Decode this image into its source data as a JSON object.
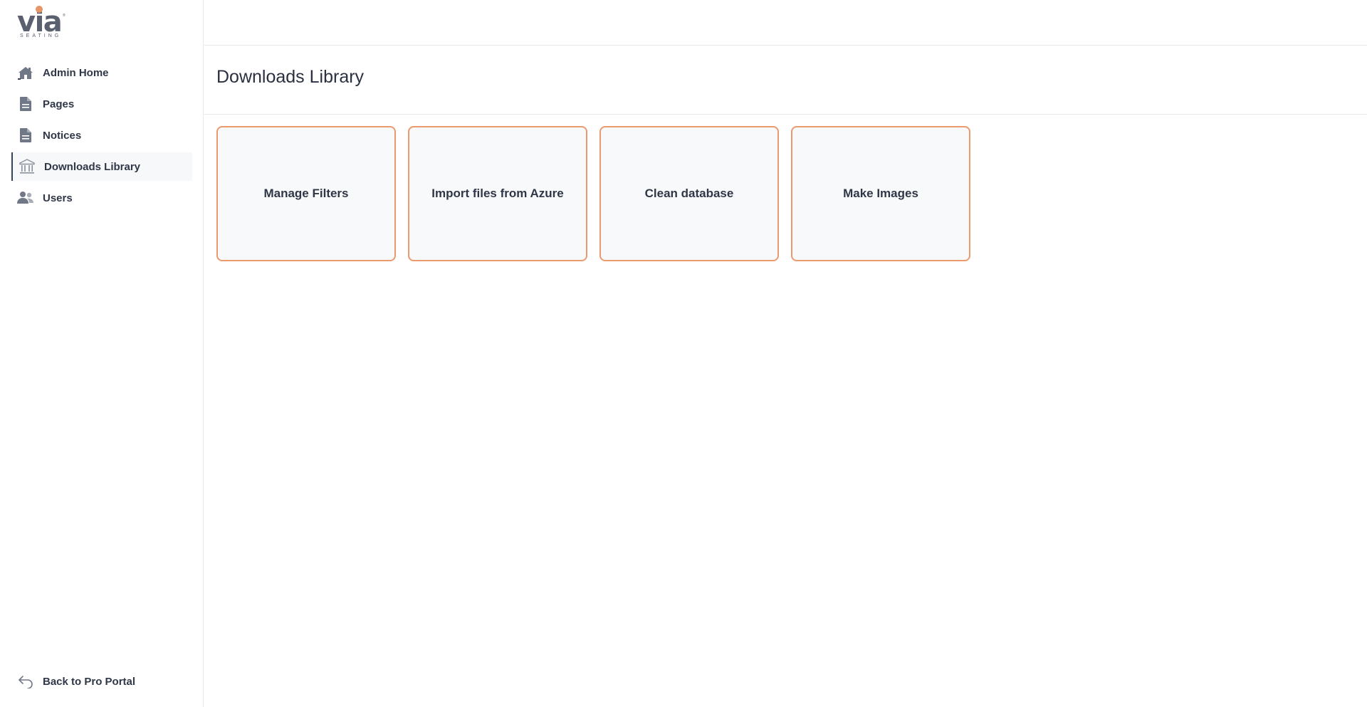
{
  "brand": {
    "name": "via",
    "tagline": "SEATING",
    "mark": "®"
  },
  "sidebar": {
    "items": [
      {
        "label": "Admin Home",
        "icon": "house-icon",
        "active": false
      },
      {
        "label": "Pages",
        "icon": "file-icon",
        "active": false
      },
      {
        "label": "Notices",
        "icon": "file-icon",
        "active": false
      },
      {
        "label": "Downloads Library",
        "icon": "building-columns-icon",
        "active": true
      },
      {
        "label": "Users",
        "icon": "users-icon",
        "active": false
      }
    ],
    "back_label": "Back to Pro Portal",
    "back_icon": "undo-arrow-icon"
  },
  "main": {
    "title": "Downloads Library",
    "cards": [
      {
        "label": "Manage Filters"
      },
      {
        "label": "Import files from Azure"
      },
      {
        "label": "Clean database"
      },
      {
        "label": "Make Images"
      }
    ]
  },
  "colors": {
    "accent": "#ea9a6d",
    "card_bg": "#f8f9fb",
    "text": "#2f3747",
    "icon": "#707786",
    "border": "#e6e8ec"
  }
}
